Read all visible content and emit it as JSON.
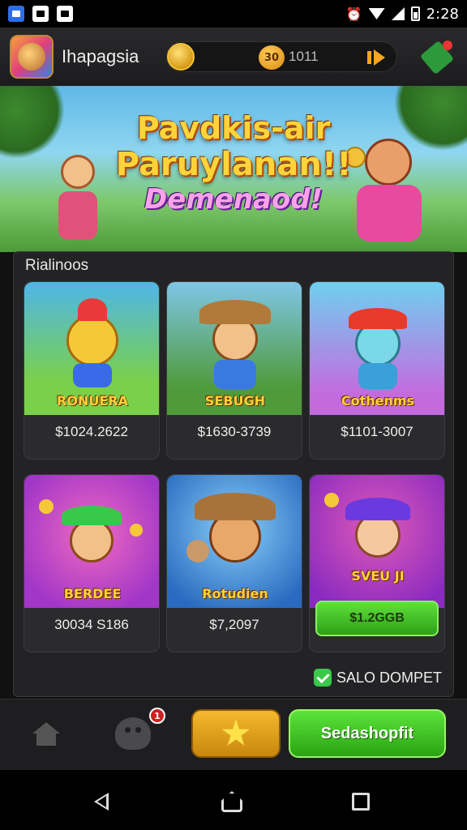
{
  "statusbar": {
    "time": "2:28"
  },
  "topbar": {
    "app_name": "Ihapagsia",
    "coin_badge": "30",
    "coin_value": "1011"
  },
  "banner": {
    "line1": "Pavdkis-air",
    "line2": "Paruylanan!!",
    "line3": "Demenaod!"
  },
  "rewards": {
    "title": "Rialinoos",
    "cards": [
      {
        "name": "RONUERA",
        "price": "$1024.2622",
        "colors": [
          "#4fb6e8",
          "#7ad04a"
        ]
      },
      {
        "name": "SEBUGH",
        "price": "$1630-3739",
        "colors": [
          "#7fc6e8",
          "#4f9a3a"
        ]
      },
      {
        "name": "Cothenms",
        "price": "$1101-3007",
        "colors": [
          "#6fd0f0",
          "#c46adf"
        ]
      },
      {
        "name": "BERDEE",
        "price": "30034 S186",
        "colors": [
          "#e04aa0",
          "#a236c8"
        ]
      },
      {
        "name": "Rotudien",
        "price": "$7,2097",
        "colors": [
          "#4aa0e8",
          "#2a6ac0"
        ]
      },
      {
        "name": "SVEU JI",
        "button": "$1.2GGB",
        "colors": [
          "#b24ae0",
          "#e05ab8"
        ]
      }
    ],
    "status_text": "SALO DOMPET"
  },
  "bottomnav": {
    "badge_count": "1",
    "cta_label": "Sedashopfit"
  },
  "colors": {
    "accent_green": "#3fcf2a",
    "accent_gold": "#f5b82e",
    "panel_bg": "#232325"
  }
}
